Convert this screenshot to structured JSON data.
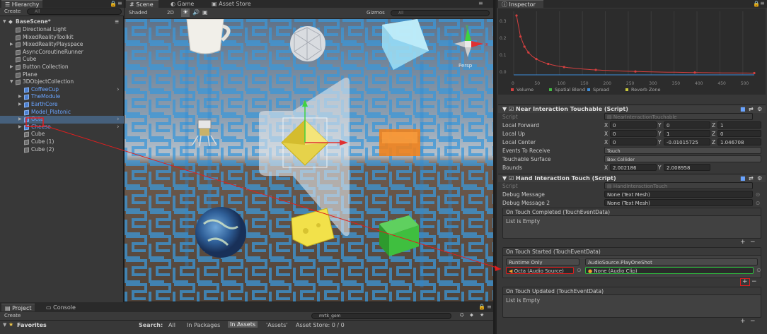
{
  "hierarchy": {
    "tab": "Hierarchy",
    "create": "Create",
    "search_placeholder": "All",
    "scene": "BaseScene*",
    "items": [
      {
        "label": "Directional Light"
      },
      {
        "label": "MixedRealityToolkit"
      },
      {
        "label": "MixedRealityPlayspace"
      },
      {
        "label": "AsyncCoroutineRunner"
      },
      {
        "label": "Cube"
      },
      {
        "label": "Button Collection"
      },
      {
        "label": "Plane"
      },
      {
        "label": "3DObjectCollection"
      },
      {
        "label": "CoffeeCup"
      },
      {
        "label": "TheModule"
      },
      {
        "label": "EarthCore"
      },
      {
        "label": "Model_Platonic"
      },
      {
        "label": "Octa"
      },
      {
        "label": "Cheese"
      },
      {
        "label": "Cube"
      },
      {
        "label": "Cube (1)"
      },
      {
        "label": "Cube (2)"
      }
    ]
  },
  "scene_tabs": {
    "scene": "Scene",
    "game": "Game",
    "asset_store": "Asset Store"
  },
  "scene_toolbar": {
    "shading": "Shaded",
    "mode_2d": "2D",
    "gizmos": "Gizmos",
    "search_placeholder": "All",
    "persp": "Persp"
  },
  "project": {
    "tabs": {
      "project": "Project",
      "console": "Console"
    },
    "create": "Create",
    "favorites": "Favorites",
    "search_value": "mrtk_gem",
    "search_label": "Search:",
    "filters": [
      "All",
      "In Packages",
      "In Assets",
      "'Assets'",
      "Asset Store: 0 / 0"
    ]
  },
  "inspector": {
    "tab": "Inspector",
    "graph_ticks": [
      "0",
      "50",
      "100",
      "150",
      "200",
      "250",
      "300",
      "350",
      "400",
      "450",
      "500"
    ],
    "graph_yticks": [
      "0.3",
      "0.2",
      "0.1",
      "0.0"
    ],
    "legend": [
      "Volume",
      "Spatial Blend",
      "Spread",
      "Reverb Zone"
    ],
    "legend_colors": [
      "#d44040",
      "#44b844",
      "#3c8cd8",
      "#c8c83c"
    ],
    "near": {
      "title": "Near Interaction Touchable (Script)",
      "script_label": "Script",
      "script_value": "NearInteractionTouchable",
      "local_forward": "Local Forward",
      "lf": [
        "0",
        "0",
        "1"
      ],
      "local_up": "Local Up",
      "lu": [
        "0",
        "1",
        "0"
      ],
      "local_center": "Local Center",
      "lc": [
        "0",
        "-0.01015725",
        "1.046708"
      ],
      "events_label": "Events To Receive",
      "events_value": "Touch",
      "surface_label": "Touchable Surface",
      "surface_value": "Box Collider",
      "bounds_label": "Bounds",
      "bounds": [
        "2.002186",
        "2.008958"
      ]
    },
    "hand": {
      "title": "Hand Interaction Touch (Script)",
      "script_label": "Script",
      "script_value": "HandInteractionTouch",
      "debug1_label": "Debug Message",
      "debug1_value": "None (Text Mesh)",
      "debug2_label": "Debug Message 2",
      "debug2_value": "None (Text Mesh)",
      "completed": "On Touch Completed (TouchEventData)",
      "empty": "List is Empty",
      "started": "On Touch Started (TouchEventData)",
      "runtime": "Runtime Only",
      "function": "AudioSource.PlayOneShot",
      "target": "Octa (Audio Source)",
      "clip": "None (Audio Clip)",
      "updated": "On Touch Updated (TouchEventData)",
      "empty2": "List is Empty"
    },
    "axis": {
      "x": "X",
      "y": "Y",
      "z": "Z"
    }
  }
}
